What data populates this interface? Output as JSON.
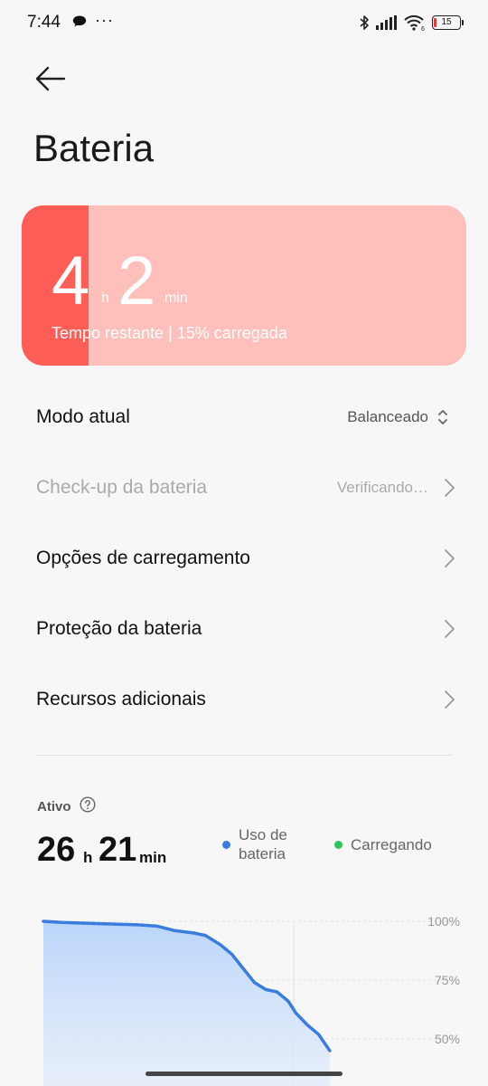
{
  "status_bar": {
    "time": "7:44",
    "dots": "···",
    "battery_level": "15"
  },
  "header": {
    "title": "Bateria"
  },
  "battery_card": {
    "hours": "4",
    "hours_unit": "h",
    "minutes": "2",
    "minutes_unit": "min",
    "subtitle": "Tempo restante | 15% carregada",
    "charge_fraction": 0.15,
    "colors": {
      "fill": "#ff5e57",
      "track": "#ffbfba"
    }
  },
  "settings": {
    "items": [
      {
        "label": "Modo atual",
        "value": "Balanceado"
      },
      {
        "label": "Check-up da bateria",
        "value": "Verificando…"
      },
      {
        "label": "Opções de carregamento",
        "value": ""
      },
      {
        "label": "Proteção da bateria",
        "value": ""
      },
      {
        "label": "Recursos adicionais",
        "value": ""
      }
    ]
  },
  "usage": {
    "label": "Ativo",
    "hours": "26",
    "hours_unit": "h",
    "minutes": "21",
    "minutes_unit": "min",
    "legend": [
      {
        "label_line1": "Uso de",
        "label_line2": "bateria",
        "color": "#3b7ddd"
      },
      {
        "label": "Carregando",
        "color": "#2ec45a"
      }
    ]
  },
  "chart_data": {
    "type": "area",
    "y_tick_labels": [
      "100%",
      "75%",
      "50%"
    ],
    "ylim": [
      0,
      100
    ],
    "series": [
      {
        "color": "#3b7ddd",
        "x": [
          0,
          0.05,
          0.15,
          0.25,
          0.3,
          0.35,
          0.4,
          0.43,
          0.47,
          0.5,
          0.53,
          0.56,
          0.59,
          0.62,
          0.65,
          0.67,
          0.7,
          0.73,
          0.76
        ],
        "y": [
          100,
          99.5,
          99,
          98.5,
          98,
          96,
          95,
          94,
          90,
          86,
          80,
          74,
          71,
          70,
          66,
          61,
          56,
          52,
          45
        ]
      }
    ]
  }
}
